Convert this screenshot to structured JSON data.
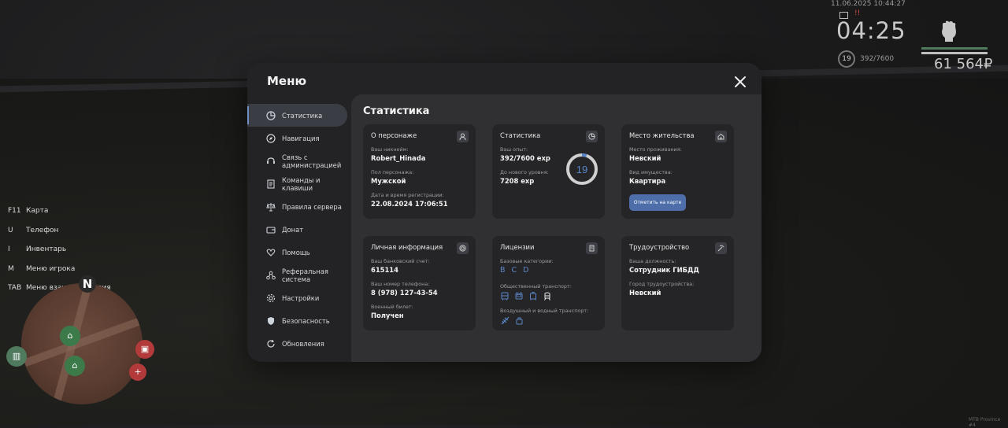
{
  "hud": {
    "datetime": "11.06.2025 10:44:27",
    "time": "04:25",
    "notif": "!!",
    "level": "19",
    "exp": "392/7600",
    "money": "61 564₽",
    "watermark": "MTB Province #4"
  },
  "keybinds": [
    {
      "key": "F11",
      "label": "Карта"
    },
    {
      "key": "U",
      "label": "Телефон"
    },
    {
      "key": "I",
      "label": "Инвентарь"
    },
    {
      "key": "M",
      "label": "Меню игрока"
    },
    {
      "key": "TAB",
      "label": "Меню взаимодействия"
    }
  ],
  "minimap": {
    "north": "N"
  },
  "menu": {
    "title": "Меню",
    "nav": [
      {
        "label": "Статистика",
        "icon": "chart-pie-icon"
      },
      {
        "label": "Навигация",
        "icon": "compass-icon"
      },
      {
        "label": "Связь с администрацией",
        "icon": "headset-icon"
      },
      {
        "label": "Команды и клавиши",
        "icon": "document-icon"
      },
      {
        "label": "Правила сервера",
        "icon": "scales-icon"
      },
      {
        "label": "Донат",
        "icon": "wallet-icon"
      },
      {
        "label": "Помощь",
        "icon": "heart-hand-icon"
      },
      {
        "label": "Реферальная система",
        "icon": "network-icon"
      },
      {
        "label": "Настройки",
        "icon": "gear-icon"
      },
      {
        "label": "Безопасность",
        "icon": "shield-icon"
      },
      {
        "label": "Обновления",
        "icon": "refresh-icon"
      }
    ]
  },
  "stats": {
    "title": "Статистика",
    "character": {
      "title": "О персонаже",
      "nick_label": "Ваш никнейм:",
      "nick": "Robert_Hinada",
      "gender_label": "Пол персонажа:",
      "gender": "Мужской",
      "reg_label": "Дата и время регистрации:",
      "reg": "22.08.2024 17:06:51"
    },
    "statistics": {
      "title": "Статистика",
      "exp_label": "Ваш опыт:",
      "exp": "392/7600 exp",
      "next_label": "До нового уровня:",
      "next": "7208 exp",
      "level": "19",
      "progress": 0.0516
    },
    "residence": {
      "title": "Место жительства",
      "place_label": "Место проживания:",
      "place": "Невский",
      "type_label": "Вид имущества:",
      "type": "Квартира",
      "button": "Отметить на карте"
    },
    "personal": {
      "title": "Личная информация",
      "bank_label": "Ваш банковский счет:",
      "bank": "615114",
      "phone_label": "Ваш номер телефона:",
      "phone": "8 (978) 127-43-54",
      "military_label": "Военный билет:",
      "military": "Получен"
    },
    "licenses": {
      "title": "Лицензии",
      "basic_label": "Базовые категории:",
      "categories": [
        "B",
        "C",
        "D"
      ],
      "public_label": "Общественный транспорт:",
      "public_icons": [
        "bus-icon",
        "trolleybus-icon",
        "tram-icon",
        "train-icon"
      ],
      "air_label": "Воздушный и водный транспорт:",
      "air_icons": [
        "plane-icon",
        "boat-icon"
      ]
    },
    "employment": {
      "title": "Трудоустройство",
      "position_label": "Ваша должность:",
      "position": "Сотрудник ГИБДД",
      "city_label": "Город трудоустройства:",
      "city": "Невский"
    }
  },
  "colors": {
    "accent": "#4d6ea8",
    "category": "#5b86c7",
    "modal": "#232325",
    "content": "#303033",
    "card": "#252527"
  }
}
